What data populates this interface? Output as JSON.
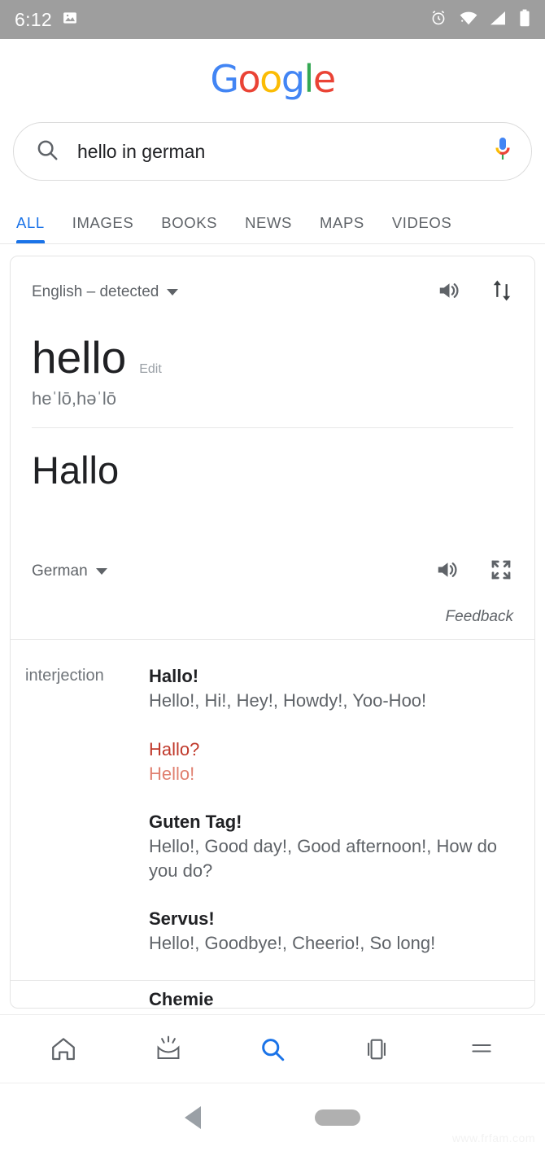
{
  "statusbar": {
    "time": "6:12",
    "icons": [
      "image-icon",
      "alarm-icon",
      "wifi-icon",
      "cell-signal-icon",
      "battery-icon"
    ]
  },
  "branding": {
    "logo_letters": [
      {
        "char": "G",
        "color": "#4285F4"
      },
      {
        "char": "o",
        "color": "#EA4335"
      },
      {
        "char": "o",
        "color": "#FBBC05"
      },
      {
        "char": "g",
        "color": "#4285F4"
      },
      {
        "char": "l",
        "color": "#34A853"
      },
      {
        "char": "e",
        "color": "#EA4335"
      }
    ]
  },
  "search": {
    "query": "hello in german",
    "placeholder": "Search",
    "search_icon": "search-icon",
    "mic_icon": "microphone-icon"
  },
  "tabs": [
    {
      "label": "ALL",
      "active": true
    },
    {
      "label": "IMAGES",
      "active": false
    },
    {
      "label": "BOOKS",
      "active": false
    },
    {
      "label": "NEWS",
      "active": false
    },
    {
      "label": "MAPS",
      "active": false
    },
    {
      "label": "VIDEOS",
      "active": false
    }
  ],
  "translate": {
    "source_language": "English – detected",
    "source_word": "hello",
    "edit_label": "Edit",
    "phonetic": "heˈlō,həˈlō",
    "target_language": "German",
    "target_word": "Hallo",
    "feedback_label": "Feedback",
    "icons": {
      "listen_source": "speaker-icon",
      "swap": "swap-vertical-icon",
      "listen_target": "speaker-icon",
      "fullscreen": "fullscreen-icon"
    }
  },
  "dictionary": {
    "part_of_speech": "interjection",
    "senses": [
      {
        "term": "Hallo!",
        "gloss": "Hello!, Hi!, Hey!, Howdy!, Yoo-Hoo!",
        "highlighted": false
      },
      {
        "term": "Hallo?",
        "gloss": "Hello!",
        "highlighted": true
      },
      {
        "term": "Guten Tag!",
        "gloss": "Hello!, Good day!, Good afternoon!, How do you do?",
        "highlighted": false
      },
      {
        "term": "Servus!",
        "gloss": "Hello!, Goodbye!, Cheerio!, So long!",
        "highlighted": false
      }
    ],
    "next_section_partial": "Chemie"
  },
  "appbar": {
    "items": [
      {
        "name": "home-icon",
        "label": "Home",
        "active": false
      },
      {
        "name": "discover-icon",
        "label": "Discover",
        "active": false
      },
      {
        "name": "search-icon",
        "label": "Search",
        "active": true
      },
      {
        "name": "tabs-icon",
        "label": "Tabs",
        "active": false
      },
      {
        "name": "menu-icon",
        "label": "More",
        "active": false
      }
    ],
    "active_color": "#1a73e8",
    "inactive_color": "#5f6368"
  },
  "navbar": {
    "back_label": "Back",
    "home_label": "Home"
  },
  "watermark": "www.frfam.com"
}
